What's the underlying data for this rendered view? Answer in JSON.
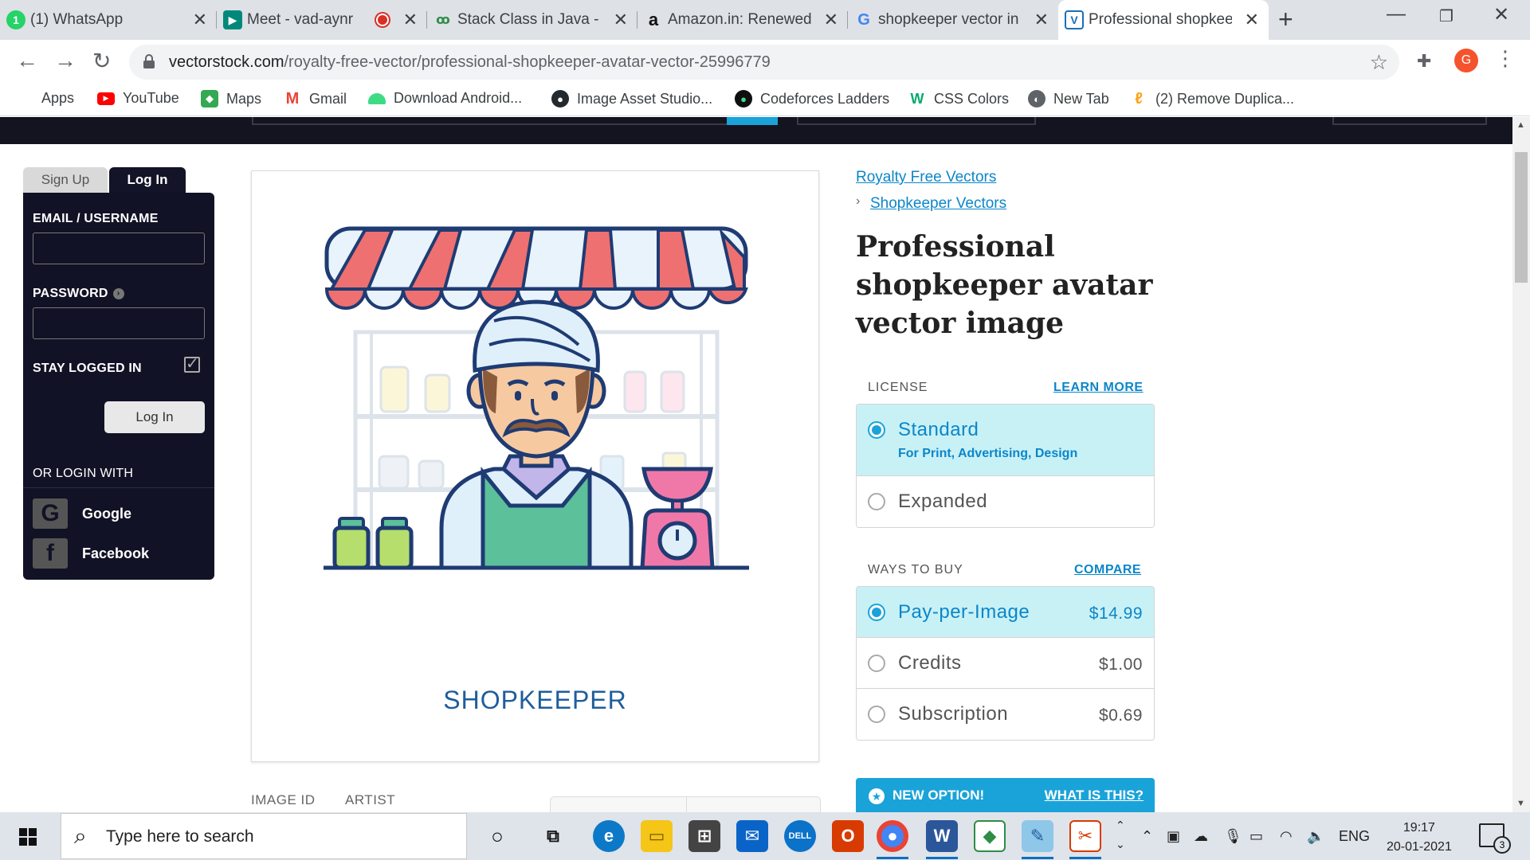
{
  "browser": {
    "tabs": [
      {
        "label": "(1) WhatsApp",
        "icon": "whatsapp-icon",
        "color": "#25d366"
      },
      {
        "label": "Meet - vad-aynr",
        "icon": "google-meet-icon",
        "color": "#00897b"
      },
      {
        "label": "Stack Class in Java - (",
        "icon": "geeksforgeeks-icon",
        "color": "#2f8d46"
      },
      {
        "label": "Amazon.in: Renewed",
        "icon": "amazon-icon",
        "color": "#ffffff"
      },
      {
        "label": "shopkeeper vector in",
        "icon": "google-icon",
        "color": "#ffffff"
      },
      {
        "label": "Professional shopkee",
        "icon": "vectorstock-icon",
        "color": "#1a6fb5"
      }
    ],
    "url_domain": "vectorstock.com",
    "url_path": "/royalty-free-vector/professional-shopkeeper-avatar-vector-25996779",
    "profile_initial": "G",
    "bookmarks": [
      {
        "label": "Apps",
        "icon": "apps-grid-icon",
        "color": "#ea4335"
      },
      {
        "label": "YouTube",
        "icon": "youtube-icon",
        "color": "#ff0000"
      },
      {
        "label": "Maps",
        "icon": "google-maps-icon",
        "color": "#34a853"
      },
      {
        "label": "Gmail",
        "icon": "gmail-icon",
        "color": "#ea4335"
      },
      {
        "label": "Download Android...",
        "icon": "android-icon",
        "color": "#3ddc84"
      },
      {
        "label": "Image Asset Studio...",
        "icon": "github-icon",
        "color": "#24292e"
      },
      {
        "label": "Codeforces Ladders",
        "icon": "codeforces-icon",
        "color": "#0f0f0f"
      },
      {
        "label": "CSS Colors",
        "icon": "w3schools-icon",
        "color": "#04aa6d"
      },
      {
        "label": "New Tab",
        "icon": "globe-icon",
        "color": "#5f6368"
      },
      {
        "label": "(2) Remove Duplica...",
        "icon": "leetcode-icon",
        "color": "#ffa116"
      }
    ]
  },
  "login": {
    "signup_tab": "Sign Up",
    "login_tab": "Log In",
    "email_label": "EMAIL / USERNAME",
    "password_label": "PASSWORD",
    "stay_label": "STAY LOGGED IN",
    "button": "Log In",
    "or_label": "OR LOGIN WITH",
    "google": "Google",
    "facebook": "Facebook"
  },
  "image": {
    "caption": "SHOPKEEPER",
    "meta_id_label": "IMAGE ID",
    "meta_artist_label": "ARTIST"
  },
  "breadcrumbs": {
    "root": "Royalty Free Vectors",
    "sep": "›",
    "child": "Shopkeeper Vectors"
  },
  "product": {
    "title": "Professional shopkeeper avatar vector image",
    "license_label": "LICENSE",
    "learn_more": "LEARN MORE",
    "licenses": [
      {
        "name": "Standard",
        "sub": "For Print, Advertising, Design",
        "selected": true
      },
      {
        "name": "Expanded",
        "sub": "",
        "selected": false
      }
    ],
    "ways_label": "WAYS TO BUY",
    "compare": "COMPARE",
    "ways": [
      {
        "name": "Pay-per-Image",
        "price": "$14.99",
        "selected": true
      },
      {
        "name": "Credits",
        "price": "$1.00",
        "selected": false
      },
      {
        "name": "Subscription",
        "price": "$0.69",
        "selected": false
      }
    ],
    "new_option": "NEW OPTION!",
    "what_is_this": "WHAT IS THIS?"
  },
  "taskbar": {
    "search_placeholder": "Type here to search",
    "language": "ENG",
    "time": "19:17",
    "date": "20-01-2021",
    "notification_count": "3",
    "colors": {
      "edge": "#0c79c8",
      "explorer": "#f5c518",
      "store": "#444444",
      "mail": "#0a64c8",
      "dell": "#0a72c8",
      "office": "#d83b01",
      "chrome": "#4285f4"
    }
  }
}
